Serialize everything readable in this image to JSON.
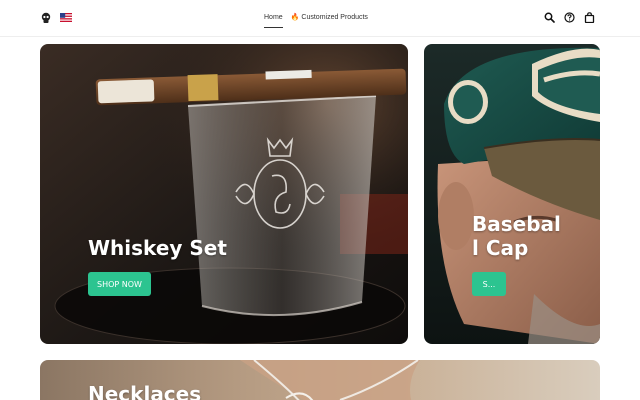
{
  "header": {
    "brand_icon": "skull-logo-icon",
    "flag_icon": "us-flag-icon",
    "nav": [
      {
        "label": "Home",
        "active": true
      },
      {
        "label": "Customized Products",
        "icon": "fire-icon",
        "active": false
      }
    ],
    "icons": [
      "search-icon",
      "help-circle-icon",
      "shopping-bag-icon"
    ]
  },
  "cards": [
    {
      "title": "Whiskey Set",
      "button": "SHOP NOW"
    },
    {
      "title": "Basebal\nl Cap",
      "button": "S..."
    },
    {
      "title": "Necklaces"
    }
  ],
  "colors": {
    "accent": "#2cc490",
    "text": "#333333"
  }
}
